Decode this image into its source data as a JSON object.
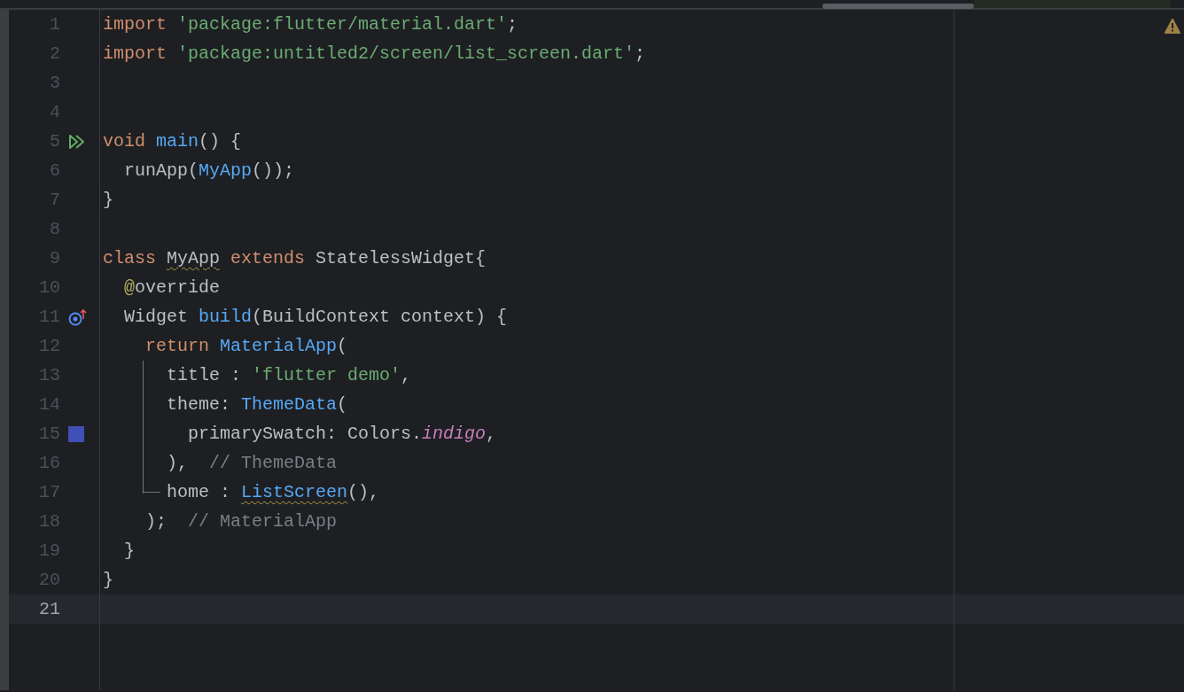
{
  "editor": {
    "lines": [
      {
        "number": "1",
        "current": false,
        "tokens": [
          {
            "text": "import ",
            "kind": "keyword"
          },
          {
            "text": "'package:flutter/material.dart'",
            "kind": "string"
          },
          {
            "text": ";",
            "kind": "plain"
          }
        ]
      },
      {
        "number": "2",
        "current": false,
        "tokens": [
          {
            "text": "import ",
            "kind": "keyword"
          },
          {
            "text": "'package:untitled2/screen/list_screen.dart'",
            "kind": "string"
          },
          {
            "text": ";",
            "kind": "plain"
          }
        ]
      },
      {
        "number": "3",
        "current": false
      },
      {
        "number": "4",
        "current": false
      },
      {
        "number": "5",
        "current": false,
        "marker": {
          "kind": "run"
        },
        "tokens": [
          {
            "text": "void ",
            "kind": "keyword"
          },
          {
            "text": "main",
            "kind": "function"
          },
          {
            "text": "() {",
            "kind": "plain"
          }
        ]
      },
      {
        "number": "6",
        "current": false,
        "tokens": [
          {
            "text": "  runApp(",
            "kind": "plain"
          },
          {
            "text": "MyApp",
            "kind": "function"
          },
          {
            "text": "());",
            "kind": "plain"
          }
        ]
      },
      {
        "number": "7",
        "current": false,
        "tokens": [
          {
            "text": "}",
            "kind": "plain"
          }
        ]
      },
      {
        "number": "8",
        "current": false
      },
      {
        "number": "9",
        "current": false,
        "tokens": [
          {
            "text": "class ",
            "kind": "keyword"
          },
          {
            "text": "MyApp",
            "kind": "plain",
            "warning": true
          },
          {
            "text": " extends ",
            "kind": "keyword"
          },
          {
            "text": "StatelessWidget{",
            "kind": "plain"
          }
        ]
      },
      {
        "number": "10",
        "current": false,
        "tokens": [
          {
            "text": "  @",
            "kind": "annotation"
          },
          {
            "text": "override",
            "kind": "plain"
          }
        ]
      },
      {
        "number": "11",
        "current": false,
        "marker": {
          "kind": "override"
        },
        "tokens": [
          {
            "text": "  Widget ",
            "kind": "plain"
          },
          {
            "text": "build",
            "kind": "function"
          },
          {
            "text": "(BuildContext context) {",
            "kind": "plain"
          }
        ]
      },
      {
        "number": "12",
        "current": false,
        "tokens": [
          {
            "text": "    return ",
            "kind": "keyword"
          },
          {
            "text": "MaterialApp",
            "kind": "function"
          },
          {
            "text": "(",
            "kind": "plain"
          }
        ]
      },
      {
        "number": "13",
        "current": false,
        "tokens": [
          {
            "text": "      title : ",
            "kind": "plain"
          },
          {
            "text": "'flutter demo'",
            "kind": "string"
          },
          {
            "text": ",",
            "kind": "plain"
          }
        ]
      },
      {
        "number": "14",
        "current": false,
        "tokens": [
          {
            "text": "      theme: ",
            "kind": "plain"
          },
          {
            "text": "ThemeData",
            "kind": "function"
          },
          {
            "text": "(",
            "kind": "plain"
          }
        ]
      },
      {
        "number": "15",
        "current": false,
        "marker": {
          "kind": "color",
          "color": "#3f51b5"
        },
        "tokens": [
          {
            "text": "        primarySwatch: Colors.",
            "kind": "plain"
          },
          {
            "text": "indigo",
            "kind": "static"
          },
          {
            "text": ",",
            "kind": "plain"
          }
        ]
      },
      {
        "number": "16",
        "current": false,
        "tokens": [
          {
            "text": "      ),  ",
            "kind": "plain"
          },
          {
            "text": "// ThemeData",
            "kind": "comment"
          }
        ]
      },
      {
        "number": "17",
        "current": false,
        "tokens": [
          {
            "text": "      home : ",
            "kind": "plain"
          },
          {
            "text": "ListScreen",
            "kind": "function",
            "warning": true
          },
          {
            "text": "(),",
            "kind": "plain"
          }
        ]
      },
      {
        "number": "18",
        "current": false,
        "tokens": [
          {
            "text": "    );  ",
            "kind": "plain"
          },
          {
            "text": "// MaterialApp",
            "kind": "comment"
          }
        ]
      },
      {
        "number": "19",
        "current": false,
        "tokens": [
          {
            "text": "  }",
            "kind": "plain"
          }
        ]
      },
      {
        "number": "20",
        "current": false,
        "tokens": [
          {
            "text": "}",
            "kind": "plain"
          }
        ]
      },
      {
        "number": "21",
        "current": true
      }
    ]
  }
}
